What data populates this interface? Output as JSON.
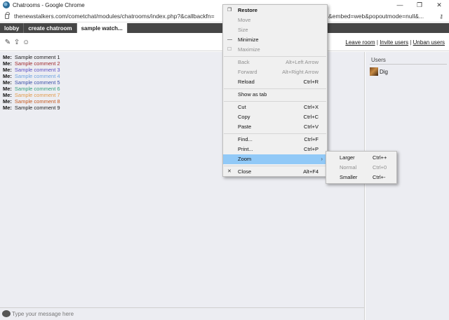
{
  "window": {
    "title": "Chatrooms - Google Chrome",
    "controls": [
      "—",
      "❐",
      "✕"
    ]
  },
  "address": {
    "url_left": "thenewstalkers.com/cometchat/modules/chatrooms/index.php?&callbackfn=",
    "url_right": "&embed=web&popoutmode=null&...",
    "key_icon": "key-icon"
  },
  "tabs": [
    {
      "label": "lobby",
      "active": false
    },
    {
      "label": "create chatroom",
      "active": false
    },
    {
      "label": "sample watch...",
      "active": true
    }
  ],
  "toolbar": {
    "icons": [
      "edit-icon",
      "upload-icon",
      "smiley-icon"
    ],
    "leave_room": "Leave room",
    "invite_users": "Invite users",
    "unban_users": "Unban users",
    "separator": "|"
  },
  "messages": [
    {
      "who": "Me:",
      "text": "Sample comment 1",
      "color": "#222222"
    },
    {
      "who": "Me:",
      "text": "Sample comment 2",
      "color": "#a0282c"
    },
    {
      "who": "Me:",
      "text": "Sample comment 3",
      "color": "#5a4fc4"
    },
    {
      "who": "Me:",
      "text": "Sample comment 4",
      "color": "#6fa3e0"
    },
    {
      "who": "Me:",
      "text": "Sample comment 5",
      "color": "#3a4fa8"
    },
    {
      "who": "Me:",
      "text": "Sample comment 6",
      "color": "#33a07c"
    },
    {
      "who": "Me:",
      "text": "Sample comment 7",
      "color": "#e29a4a"
    },
    {
      "who": "Me:",
      "text": "Sample comment 8",
      "color": "#c4581e"
    },
    {
      "who": "Me:",
      "text": "Sample comment 9",
      "color": "#222222"
    }
  ],
  "users": {
    "title": "Users",
    "list": [
      {
        "name": "Dig"
      }
    ]
  },
  "composer": {
    "placeholder": "Type your message here"
  },
  "context_menu": {
    "items": [
      {
        "label": "Restore",
        "shortcut": "",
        "icon": "❐",
        "disabled": false,
        "bold": true
      },
      {
        "label": "Move",
        "shortcut": "",
        "icon": "",
        "disabled": true
      },
      {
        "label": "Size",
        "shortcut": "",
        "icon": "",
        "disabled": true
      },
      {
        "label": "Minimize",
        "shortcut": "",
        "icon": "—",
        "disabled": false
      },
      {
        "label": "Maximize",
        "shortcut": "",
        "icon": "☐",
        "disabled": true
      },
      {
        "label": "Back",
        "shortcut": "Alt+Left Arrow",
        "icon": "",
        "disabled": true
      },
      {
        "label": "Forward",
        "shortcut": "Alt+Right Arrow",
        "icon": "",
        "disabled": true
      },
      {
        "label": "Reload",
        "shortcut": "Ctrl+R",
        "icon": "",
        "disabled": false
      },
      {
        "label": "Show as tab",
        "shortcut": "",
        "icon": "",
        "disabled": false
      },
      {
        "label": "Cut",
        "shortcut": "Ctrl+X",
        "icon": "",
        "disabled": false
      },
      {
        "label": "Copy",
        "shortcut": "Ctrl+C",
        "icon": "",
        "disabled": false
      },
      {
        "label": "Paste",
        "shortcut": "Ctrl+V",
        "icon": "",
        "disabled": false
      },
      {
        "label": "Find...",
        "shortcut": "Ctrl+F",
        "icon": "",
        "disabled": false
      },
      {
        "label": "Print...",
        "shortcut": "Ctrl+P",
        "icon": "",
        "disabled": false
      },
      {
        "label": "Zoom",
        "shortcut": "",
        "icon": "",
        "disabled": false,
        "highlighted": true,
        "submenu_arrow": "›"
      },
      {
        "label": "Close",
        "shortcut": "Alt+F4",
        "icon": "✕",
        "disabled": false
      }
    ]
  },
  "zoom_submenu": {
    "items": [
      {
        "label": "Larger",
        "shortcut": "Ctrl++",
        "disabled": false
      },
      {
        "label": "Normal",
        "shortcut": "Ctrl+0",
        "disabled": true
      },
      {
        "label": "Smaller",
        "shortcut": "Ctrl+-",
        "disabled": false
      }
    ]
  }
}
